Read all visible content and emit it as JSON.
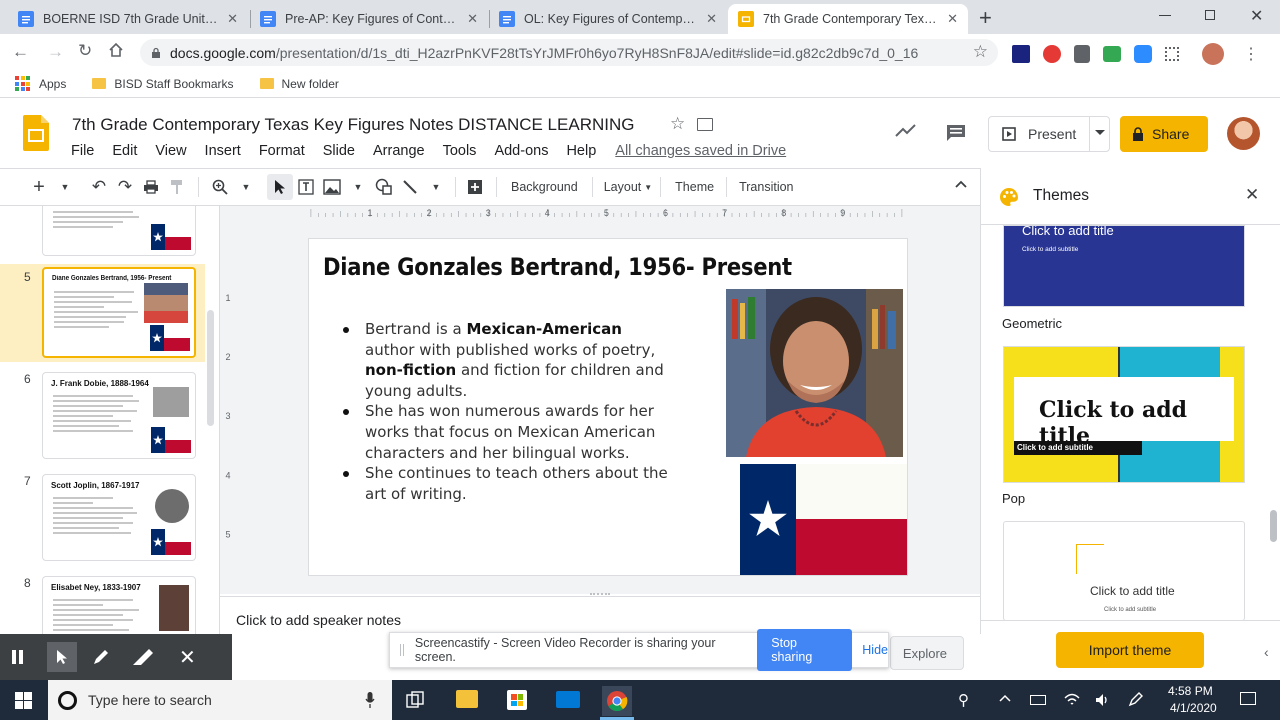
{
  "browser": {
    "tabs": [
      {
        "title": "BOERNE ISD 7th Grade Unit 12 D",
        "icon": "docs-icon",
        "active": false
      },
      {
        "title": "Pre-AP: Key Figures of Contempo",
        "icon": "docs-icon",
        "active": false
      },
      {
        "title": "OL: Key Figures of Contemporary",
        "icon": "docs-icon",
        "active": false
      },
      {
        "title": "7th Grade Contemporary Texas K",
        "icon": "slides-icon",
        "active": true
      }
    ],
    "new_tab": "+",
    "url_host": "docs.google.com",
    "url_path": "/presentation/d/1s_dti_H2azrPnKVF28tTsYrJMFr0h6yo7RyH8SnF8JA/edit#slide=id.g82c2db9c7d_0_16",
    "bookmarks": [
      {
        "label": "Apps",
        "icon": "apps-grid-icon"
      },
      {
        "label": "BISD Staff Bookmarks",
        "icon": "folder-icon"
      },
      {
        "label": "New folder",
        "icon": "folder-icon"
      }
    ]
  },
  "doc": {
    "title": "7th Grade Contemporary Texas Key Figures Notes DISTANCE LEARNING",
    "menu": [
      "File",
      "Edit",
      "View",
      "Insert",
      "Format",
      "Slide",
      "Arrange",
      "Tools",
      "Add-ons",
      "Help"
    ],
    "save_status": "All changes saved in Drive",
    "present_label": "Present",
    "share_label": "Share"
  },
  "toolbar": {
    "background": "Background",
    "layout": "Layout",
    "theme": "Theme",
    "transition": "Transition"
  },
  "filmstrip": [
    {
      "num": "5",
      "title": "Diane Gonzales Bertrand, 1956- Present",
      "selected": true
    },
    {
      "num": "6",
      "title": "J. Frank Dobie, 1888-1964",
      "selected": false
    },
    {
      "num": "7",
      "title": "Scott Joplin, 1867-1917",
      "selected": false
    },
    {
      "num": "8",
      "title": "Elisabet Ney, 1833-1907",
      "selected": false
    }
  ],
  "ruler": {
    "h": [
      "1",
      "2",
      "3",
      "4",
      "5",
      "6",
      "7",
      "8",
      "9"
    ],
    "v": [
      "1",
      "2",
      "3",
      "4",
      "5"
    ]
  },
  "slide": {
    "title": "Diane Gonzales Bertrand, 1956- Present",
    "b1_a": "Bertrand is a ",
    "b1_b": "Mexican-American",
    "b1_c": " author with published works of poetry,",
    "b1_d": "non-fiction",
    "b1_e": " and fiction for children and young adults.",
    "b2": "She has won numerous awards for her works that focus on Mexican American characters and her bilingual works.",
    "b3": "She continues to teach others about the art of writing."
  },
  "speaker_notes_placeholder": "Click to add speaker notes",
  "themes_panel": {
    "title": "Themes",
    "themes": [
      {
        "label": "",
        "title_text": "Click to add title",
        "subtitle_text": "Click to add subtitle"
      },
      {
        "label": "Geometric",
        "title_text": "Click to add title",
        "subtitle_text": "Click to add subtitle"
      },
      {
        "label": "Pop",
        "title_text": "Click to add title",
        "subtitle_text": "Click to add subtitle"
      }
    ],
    "import_label": "Import theme",
    "explore_label": "Explore"
  },
  "screencastify": {
    "message": "Screencastify - Screen Video Recorder is sharing your screen.",
    "stop_label": "Stop sharing",
    "hide_label": "Hide"
  },
  "taskbar": {
    "search_placeholder": "Type here to search",
    "time": "4:58 PM",
    "date": "4/1/2020"
  },
  "colors": {
    "share_yellow": "#f4b400",
    "slides_yellow": "#f4b400",
    "stop_blue": "#4285f4",
    "texas_blue": "#002868",
    "texas_red": "#bf0a30"
  }
}
